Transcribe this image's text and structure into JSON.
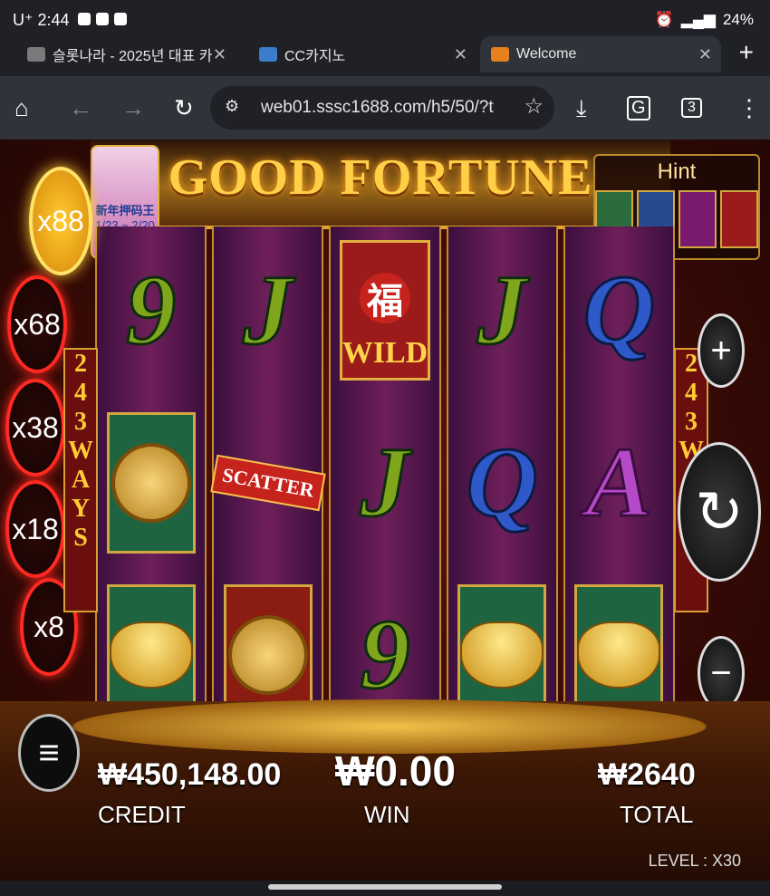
{
  "status_bar": {
    "carrier": "U⁺",
    "time": "2:44",
    "battery": "24%"
  },
  "tabs": [
    {
      "title": "슬롯나라 - 2025년 대표 카"
    },
    {
      "title": "CC카지노"
    },
    {
      "title": "Welcome",
      "active": true
    }
  ],
  "browser": {
    "url": "web01.sssc1688.com/h5/50/?t",
    "tab_count": "3"
  },
  "game": {
    "title": "GOOD FORTUNE",
    "hint_label": "Hint",
    "multipliers": [
      "x88",
      "x68",
      "x38",
      "x18",
      "x8"
    ],
    "ways_text": [
      "2",
      "4",
      "3",
      "W",
      "A",
      "Y",
      "S"
    ],
    "wild_label": "WILD",
    "scatter_label": "SCATTER",
    "promo": {
      "line1": "新年押码王",
      "line2": "1/23 ~ 2/20"
    },
    "credit_value": "₩450,148.00",
    "credit_label": "CREDIT",
    "win_value": "₩0.00",
    "win_label": "WIN",
    "total_value": "₩2640",
    "total_label": "TOTAL",
    "level_text": "LEVEL : X30",
    "reels": [
      [
        "9",
        "coin",
        "ingot"
      ],
      [
        "J",
        "scatter",
        "medallion"
      ],
      [
        "wild",
        "J",
        "9"
      ],
      [
        "J",
        "Q",
        "ingot"
      ],
      [
        "Q",
        "A",
        "ingot"
      ]
    ]
  }
}
